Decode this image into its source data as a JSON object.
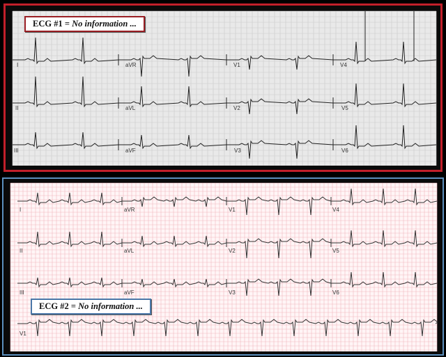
{
  "ecg1": {
    "label_prefix": "ECG #1 = ",
    "label_italic": "No information ...",
    "leads": [
      "I",
      "aVR",
      "V1",
      "V4",
      "II",
      "aVL",
      "V2",
      "V5",
      "III",
      "aVF",
      "V3",
      "V6"
    ],
    "paper_color": "#e9e9e9",
    "grid_color": "#c9c9c9",
    "trace_color": "#222222"
  },
  "ecg2": {
    "label_prefix": "ECG #2 = ",
    "label_italic": "No information ...",
    "leads": [
      "I",
      "aVR",
      "V1",
      "V4",
      "II",
      "aVL",
      "V2",
      "V5",
      "III",
      "aVF",
      "V3",
      "V6",
      "V1"
    ],
    "paper_color": "#fff5f6",
    "grid_color": "#f2b9c0",
    "trace_color": "#333333"
  },
  "colors": {
    "panel1_border": "#c21f2a",
    "panel2_border": "#5b8fbd"
  }
}
